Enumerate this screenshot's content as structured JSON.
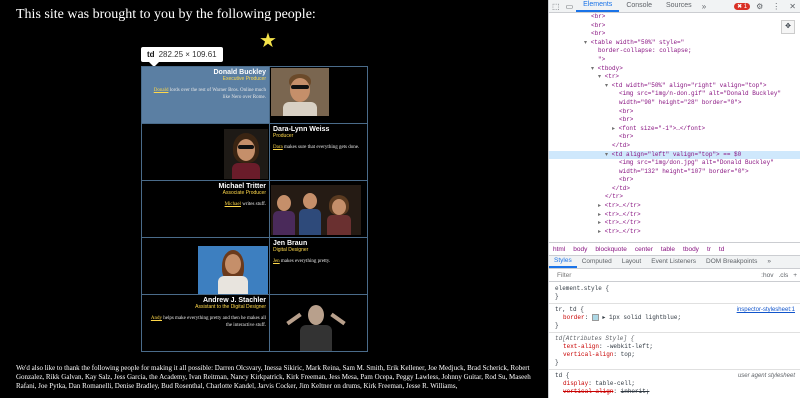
{
  "page": {
    "heading": "This site was brought to you by the following people:",
    "tooltip": {
      "tag": "td",
      "size": "282.25 × 109.61"
    },
    "people": [
      {
        "name": "Donald Buckley",
        "role": "Executive Producer",
        "link": "Donald",
        "bio": " lords over the rest of Warner Bros. Online much like Nero over Rome."
      },
      {
        "name": "Dara-Lynn Weiss",
        "role": "Producer",
        "link": "Dara",
        "bio": " makes sure that everything gets done."
      },
      {
        "name": "Michael Tritter",
        "role": "Associate Producer",
        "link": "Michael",
        "bio": " writes stuff."
      },
      {
        "name": "Jen Braun",
        "role": "Digital Designer",
        "link": "Jen",
        "bio": " makes everything pretty."
      },
      {
        "name": "Andrew J. Stachler",
        "role": "Assistant to the Digital Designer",
        "link": "Andy",
        "bio": " helps make everything pretty and then he makes all the interactive stuff."
      }
    ],
    "thanks": "We'd also like to thank the following people for making it all possible: Darren Olcsvary, Inessa Sikiric, Mark Reina, Sam M. Smith, Erik Kellener, Joe Medjuck, Brad Scherick, Robert Gonzalez, Rikk Galvan, Kay Salz, Jess Garcia, the Academy, Ivan Reitman, Nancy Kirkpatrick, Kirk Freeman, Jess Mesa, Pam Ocepa, Peggy Lawless, Johnny Guitar, Rod Su, Maseeh Rafani, Joe Pytka, Dan Romanelli, Denise Bradley, Bud Rosenthal, Charlotte Kandel, Jarvis Cocker, Jim Keltner on drums, Kirk Freeman, Jesse R. Williams,"
  },
  "devtools": {
    "tabs": [
      "Elements",
      "Console",
      "Sources"
    ],
    "more": "»",
    "error_count": "1",
    "elements": [
      {
        "indent": 6,
        "html": "<br>"
      },
      {
        "indent": 6,
        "html": "<br>"
      },
      {
        "indent": 6,
        "html": "<br>"
      },
      {
        "indent": 5,
        "tri": "▾",
        "html": "<table width=\"50%\" style=\""
      },
      {
        "indent": 7,
        "html": "border-collapse: collapse;"
      },
      {
        "indent": 7,
        "html": "\">"
      },
      {
        "indent": 6,
        "tri": "▾",
        "html": "<tbody>"
      },
      {
        "indent": 7,
        "tri": "▾",
        "html": "<tr>"
      },
      {
        "indent": 8,
        "tri": "▾",
        "html": "<td width=\"50%\" align=\"right\" valign=\"top\">"
      },
      {
        "indent": 10,
        "html": "<img src=\"img/n-don.gif\" alt=\"Donald Buckley\""
      },
      {
        "indent": 10,
        "html": "width=\"90\" height=\"28\" border=\"0\">"
      },
      {
        "indent": 10,
        "html": "<br>"
      },
      {
        "indent": 10,
        "html": "<br>"
      },
      {
        "indent": 9,
        "tri": "▸",
        "html": "<font size=\"-1\">…</font>"
      },
      {
        "indent": 10,
        "html": "<br>"
      },
      {
        "indent": 9,
        "html": "</td>"
      },
      {
        "indent": 8,
        "tri": "▾",
        "html": "<td align=\"left\" valign=\"top\"> == $0",
        "sel": true
      },
      {
        "indent": 10,
        "html": "<img src=\"img/don.jpg\" alt=\"Donald Buckley\""
      },
      {
        "indent": 10,
        "html": "width=\"132\" height=\"107\" border=\"0\">"
      },
      {
        "indent": 10,
        "html": "<br>"
      },
      {
        "indent": 9,
        "html": "</td>"
      },
      {
        "indent": 8,
        "html": "</tr>"
      },
      {
        "indent": 7,
        "tri": "▸",
        "html": "<tr>…</tr>"
      },
      {
        "indent": 7,
        "tri": "▸",
        "html": "<tr>…</tr>"
      },
      {
        "indent": 7,
        "tri": "▸",
        "html": "<tr>…</tr>"
      },
      {
        "indent": 7,
        "tri": "▸",
        "html": "<tr>…</tr>"
      }
    ],
    "breadcrumbs": [
      "html",
      "body",
      "blockquote",
      "center",
      "table",
      "tbody",
      "tr",
      "td"
    ],
    "subtabs": [
      "Styles",
      "Computed",
      "Layout",
      "Event Listeners",
      "DOM Breakpoints",
      "»"
    ],
    "filter": {
      "placeholder": "Filter",
      "hov": ":hov",
      "cls": ".cls",
      "plus": "+"
    },
    "rules": [
      {
        "selector": "element.style {",
        "source": "",
        "lines": [],
        "close": "}"
      },
      {
        "selector": "tr, td {",
        "source": "inspector-stylesheet:1",
        "lines": [
          {
            "prop": "border",
            "value": "▸ 1px solid lightblue;"
          }
        ],
        "close": "}"
      },
      {
        "selector": "td[Attributes Style] {",
        "source": "",
        "lines": [
          {
            "prop": "text-align",
            "value": "-webkit-left;"
          },
          {
            "prop": "vertical-align",
            "value": "top;"
          }
        ],
        "close": "}"
      },
      {
        "selector": "td {",
        "source": "user agent stylesheet",
        "lines": [
          {
            "prop": "display",
            "value": "table-cell;"
          },
          {
            "prop": "vertical-align",
            "value": "inherit;",
            "strike": true
          }
        ],
        "close": ""
      }
    ]
  }
}
